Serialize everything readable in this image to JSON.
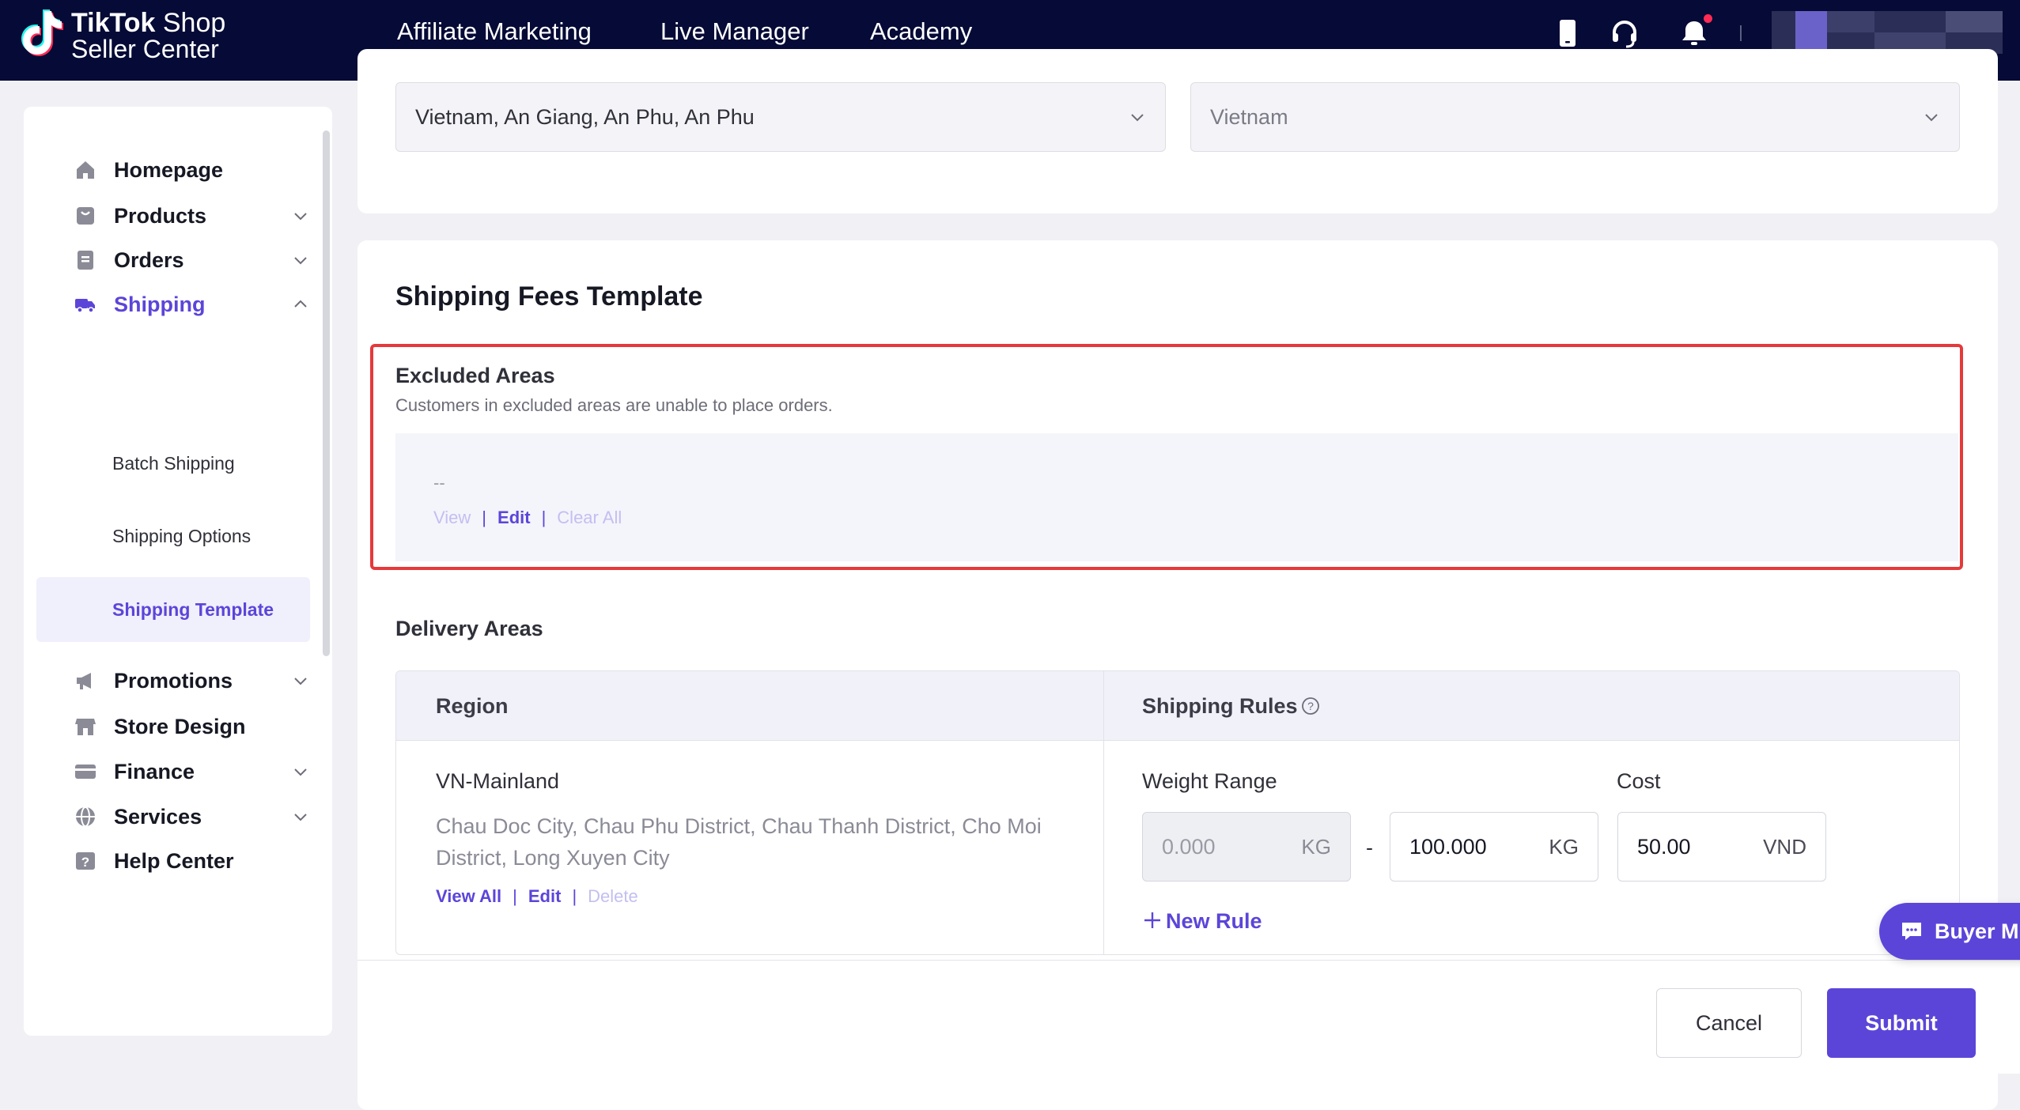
{
  "brand": {
    "line1_bold": "TikTok",
    "line1_rest": " Shop",
    "line2": "Seller Center"
  },
  "topnav": {
    "items": [
      "Affiliate Marketing",
      "Live Manager",
      "Academy"
    ]
  },
  "topbar_icons": [
    "mobile-icon",
    "headset-icon",
    "bell-icon"
  ],
  "sidebar": {
    "items": [
      {
        "label": "Homepage",
        "icon": "home-icon"
      },
      {
        "label": "Products",
        "icon": "bag-icon"
      },
      {
        "label": "Orders",
        "icon": "document-icon"
      },
      {
        "label": "Shipping",
        "icon": "truck-icon"
      },
      {
        "label": "Promotions",
        "icon": "megaphone-icon"
      },
      {
        "label": "Store Design",
        "icon": "store-icon"
      },
      {
        "label": "Finance",
        "icon": "card-icon"
      },
      {
        "label": "Services",
        "icon": "globe-icon"
      },
      {
        "label": "Help Center",
        "icon": "help-icon"
      }
    ],
    "shipping_sub": [
      "Batch Shipping",
      "Shipping Options",
      "Shipping Template"
    ],
    "selected_sub": "Shipping Template"
  },
  "address": {
    "location": "Vietnam, An Giang, An Phu, An Phu",
    "country": "Vietnam"
  },
  "template": {
    "title": "Shipping Fees Template",
    "excluded": {
      "title": "Excluded Areas",
      "description": "Customers in excluded areas are unable to place orders.",
      "placeholder": "--",
      "view": "View",
      "edit": "Edit",
      "clear_all": "Clear All"
    },
    "delivery": {
      "title": "Delivery Areas",
      "col_region": "Region",
      "col_rules": "Shipping Rules",
      "region_name": "VN-Mainland",
      "region_list": "Chau Doc City, Chau Phu District, Chau Thanh District, Cho Moi District, Long Xuyen City",
      "view_all": "View All",
      "edit": "Edit",
      "delete": "Delete",
      "weight_label": "Weight Range",
      "cost_label": "Cost",
      "weight_min": "0.000",
      "weight_max": "100.000",
      "weight_unit": "KG",
      "range_sep": "-",
      "cost_value": "50.00",
      "cost_unit": "VND",
      "new_rule": "New Rule"
    }
  },
  "footer": {
    "cancel": "Cancel",
    "submit": "Submit"
  },
  "floating": {
    "label": "Buyer M"
  },
  "colors": {
    "topbar": "#050a36",
    "accent": "#5b45d9",
    "highlight": "#e5393b",
    "notification": "#fe2c55"
  }
}
